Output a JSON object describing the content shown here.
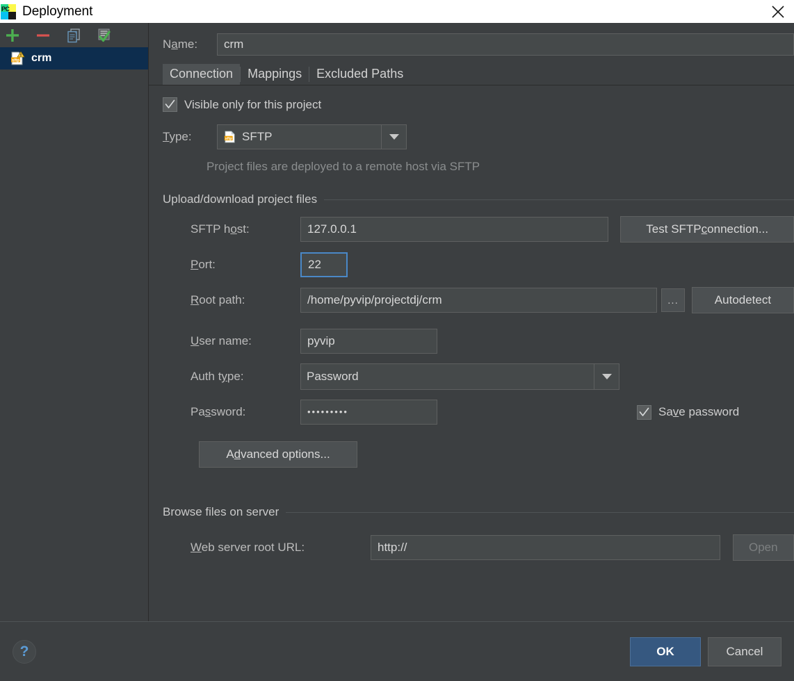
{
  "window": {
    "title": "Deployment",
    "app_icon": "pycharm-logo-icon",
    "close_icon": "close-icon"
  },
  "sidebar": {
    "toolbar": [
      {
        "name": "add-server-button",
        "icon": "plus-icon",
        "label": "+"
      },
      {
        "name": "remove-server-button",
        "icon": "minus-icon",
        "label": "−"
      },
      {
        "name": "copy-server-button",
        "icon": "copy-icon",
        "label": "Copy"
      },
      {
        "name": "set-default-server-button",
        "icon": "checkmark-list-icon",
        "label": "Use as default"
      }
    ],
    "items": [
      {
        "label": "crm",
        "icon": "sftp-server-icon",
        "selected": true
      }
    ]
  },
  "form": {
    "name_label": "Name:",
    "name_value": "crm",
    "tabs": [
      {
        "label": "Connection",
        "active": true
      },
      {
        "label": "Mappings",
        "active": false
      },
      {
        "label": "Excluded Paths",
        "active": false
      }
    ],
    "visible_only_checkbox": {
      "label": "Visible only for this project",
      "checked": true
    },
    "type_label": "Type:",
    "type_value": "SFTP",
    "type_icon": "sftp-file-icon",
    "type_hint": "Project files are deployed to a remote host via SFTP",
    "upload_group_title": "Upload/download project files",
    "sftp_host_label": "SFTP host:",
    "sftp_host_value": "127.0.0.1",
    "test_connection_label": "Test SFTP connection...",
    "port_label": "Port:",
    "port_value": "22",
    "root_path_label": "Root path:",
    "root_path_value": "/home/pyvip/projectdj/crm",
    "browse_button_label": "...",
    "autodetect_label": "Autodetect",
    "user_name_label": "User name:",
    "user_name_value": "pyvip",
    "auth_type_label": "Auth type:",
    "auth_type_value": "Password",
    "password_label": "Password:",
    "password_value": "•••••••••",
    "save_password_checkbox": {
      "label": "Save password",
      "checked": true
    },
    "advanced_options_label": "Advanced options...",
    "browse_group_title": "Browse files on server",
    "web_url_label": "Web server root URL:",
    "web_url_value": "http://",
    "open_button_label": "Open",
    "open_button_enabled": false
  },
  "footer": {
    "help_icon": "help-question-icon",
    "help_label": "?",
    "ok_label": "OK",
    "cancel_label": "Cancel"
  },
  "colors": {
    "background": "#3c3f41",
    "titlebar": "#ffffff",
    "selection": "#0d2d4e",
    "accent": "#365880",
    "focus_border": "#4a88c7",
    "text": "#d8d8d8",
    "muted_text": "#8a8d8e"
  }
}
